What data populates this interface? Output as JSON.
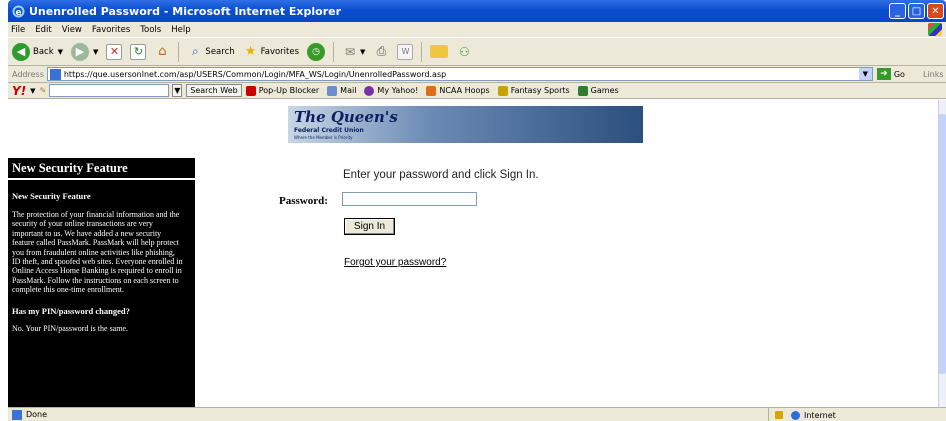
{
  "window": {
    "title": "Unenrolled Password - Microsoft Internet Explorer"
  },
  "menu": [
    "File",
    "Edit",
    "View",
    "Favorites",
    "Tools",
    "Help"
  ],
  "toolbar": {
    "back": "Back",
    "search": "Search",
    "favorites": "Favorites"
  },
  "address": {
    "label": "Address",
    "url": "https://que.usersonlnet.com/asp/USERS/Common/Login/MFA_WS/Login/UnenrolledPassword.asp",
    "go": "Go",
    "links": "Links"
  },
  "yahoo": {
    "logo": "Y!",
    "search_web": "Search Web",
    "popup_blocker": "Pop-Up Blocker",
    "mail": "Mail",
    "my_yahoo": "My Yahoo!",
    "ncaa": "NCAA Hoops",
    "fantasy": "Fantasy Sports",
    "games": "Games"
  },
  "logo": {
    "title": "The Queen's",
    "subtitle": "Federal Credit Union",
    "tagline": "Where the Member is Priority"
  },
  "sidebar": {
    "heading": "New Security Feature",
    "subheading": "New Security Feature",
    "body": "The protection of your financial information and the security of your online transactions are very important to us. We have added a new security feature called PassMark. PassMark will help protect you from fraudulent online activities like phishing, ID theft, and spoofed web sites. Everyone enrolled in Online Access Home Banking is required to enroll in PassMark. Follow the instructions on each screen to complete this one-time enrollment.",
    "question": "Has my PIN/password changed?",
    "answer": "No. Your PIN/password is the same."
  },
  "login": {
    "prompt": "Enter your password and click Sign In.",
    "password_label": "Password:",
    "password_value": "",
    "sign_in": "Sign In",
    "forgot": "Forgot your password?"
  },
  "status": {
    "left": "Done",
    "zone": "Internet"
  },
  "colors": {
    "titlebar": "#0a4fd0",
    "sidebar_bg": "#000000",
    "chrome": "#ece9d8"
  }
}
